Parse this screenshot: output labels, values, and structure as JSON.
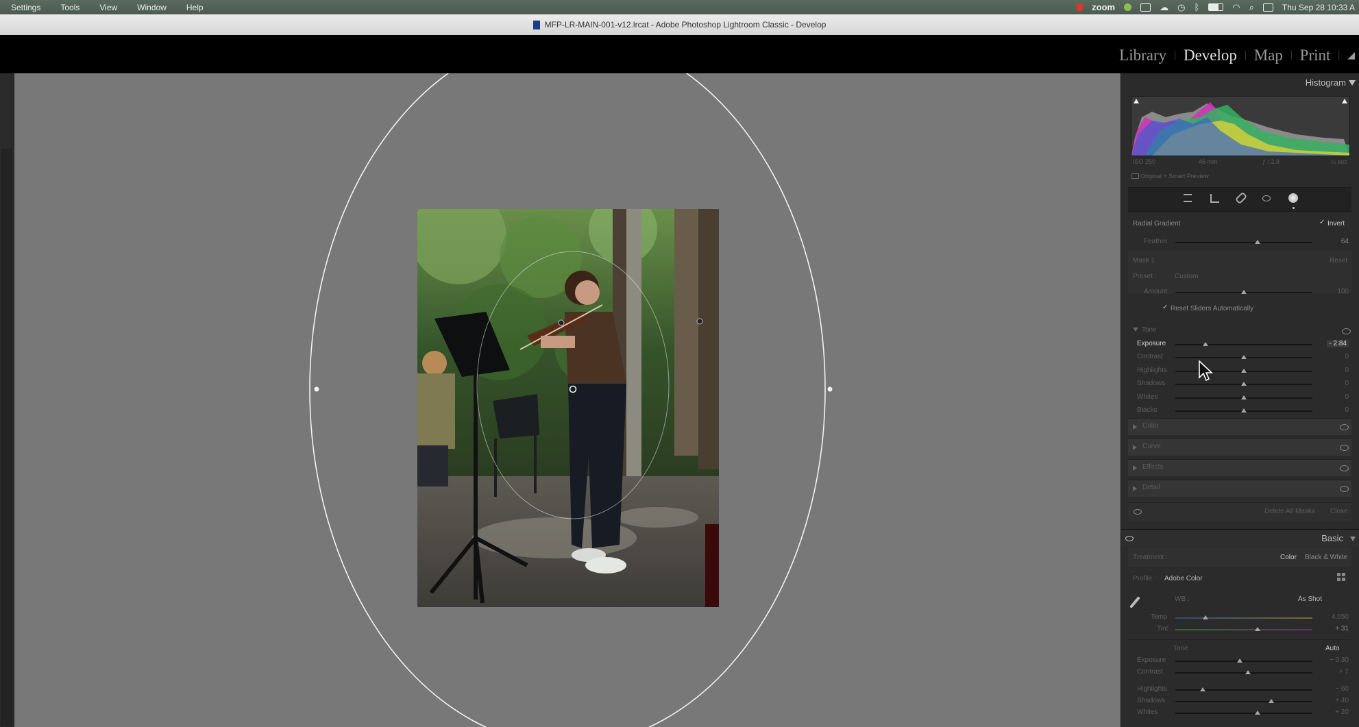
{
  "menubar": {
    "items": [
      "Settings",
      "Tools",
      "View",
      "Window",
      "Help"
    ],
    "zoom_label": "zoom",
    "clock": "Thu Sep 28  10:33 A"
  },
  "window": {
    "title": "MFP-LR-MAIN-001-v12.lrcat - Adobe Photoshop Lightroom Classic - Develop"
  },
  "modules": {
    "library": "Library",
    "develop": "Develop",
    "map": "Map",
    "print": "Print",
    "separator": "|"
  },
  "histogram": {
    "title": "Histogram",
    "iso": "ISO 250",
    "focal": "46 mm",
    "aperture": "ƒ / 2.8",
    "shutter": "¼ sec",
    "preview": "Original + Smart Preview"
  },
  "tools": [
    "sliders-icon",
    "crop-icon",
    "healing-brush-icon",
    "redeye-icon",
    "masking-icon"
  ],
  "mask_panel": {
    "type_label": "Radial Gradient",
    "invert_label": "Invert",
    "feather_label": "Feather",
    "feather_value": "64",
    "feather_pos": 0.6,
    "mask_name": "Mask 1",
    "reset_label": "Reset",
    "preset_label": "Preset :",
    "preset_value": "Custom",
    "amount_label": "Amount",
    "amount_value": "100",
    "amount_pos": 0.5,
    "reset_sliders_label": "Reset Sliders Automatically",
    "tone_label": "Tone",
    "sliders": [
      {
        "label": "Exposure",
        "value": "- 2.84",
        "pos": 0.22,
        "active": true
      },
      {
        "label": "Contrast",
        "value": "0",
        "pos": 0.5,
        "active": false
      },
      {
        "label": "Highlights",
        "value": "0",
        "pos": 0.5,
        "active": false
      },
      {
        "label": "Shadows",
        "value": "0",
        "pos": 0.5,
        "active": false
      },
      {
        "label": "Whites",
        "value": "0",
        "pos": 0.5,
        "active": false
      },
      {
        "label": "Blacks",
        "value": "0",
        "pos": 0.5,
        "active": false
      }
    ],
    "sections": [
      "Color",
      "Curve",
      "Effects",
      "Detail"
    ],
    "delete_all_label": "Delete All Masks",
    "close_label": "Close"
  },
  "basic_panel": {
    "title": "Basic",
    "treatment_label": "Treatment :",
    "color_label": "Color",
    "bw_label": "Black & White",
    "profile_label": "Profile :",
    "profile_value": "Adobe Color",
    "wb_label": "WB :",
    "wb_value": "As Shot",
    "temp_label": "Temp",
    "temp_value": "4,050",
    "temp_pos": 0.22,
    "tint_label": "Tint",
    "tint_value": "+ 31",
    "tint_pos": 0.6,
    "tone_label": "Tone",
    "auto_label": "Auto",
    "sliders": [
      {
        "label": "Exposure",
        "value": "− 0.30",
        "pos": 0.47
      },
      {
        "label": "Contrast",
        "value": "+ 7",
        "pos": 0.53
      },
      {
        "label": "Highlights",
        "value": "− 60",
        "pos": 0.2
      },
      {
        "label": "Shadows",
        "value": "+ 40",
        "pos": 0.7
      },
      {
        "label": "Whites",
        "value": "+ 20",
        "pos": 0.6
      }
    ]
  },
  "colors": {
    "canvas": "#787878",
    "panel": "#2b2b2b",
    "menubar": "#53645a"
  }
}
